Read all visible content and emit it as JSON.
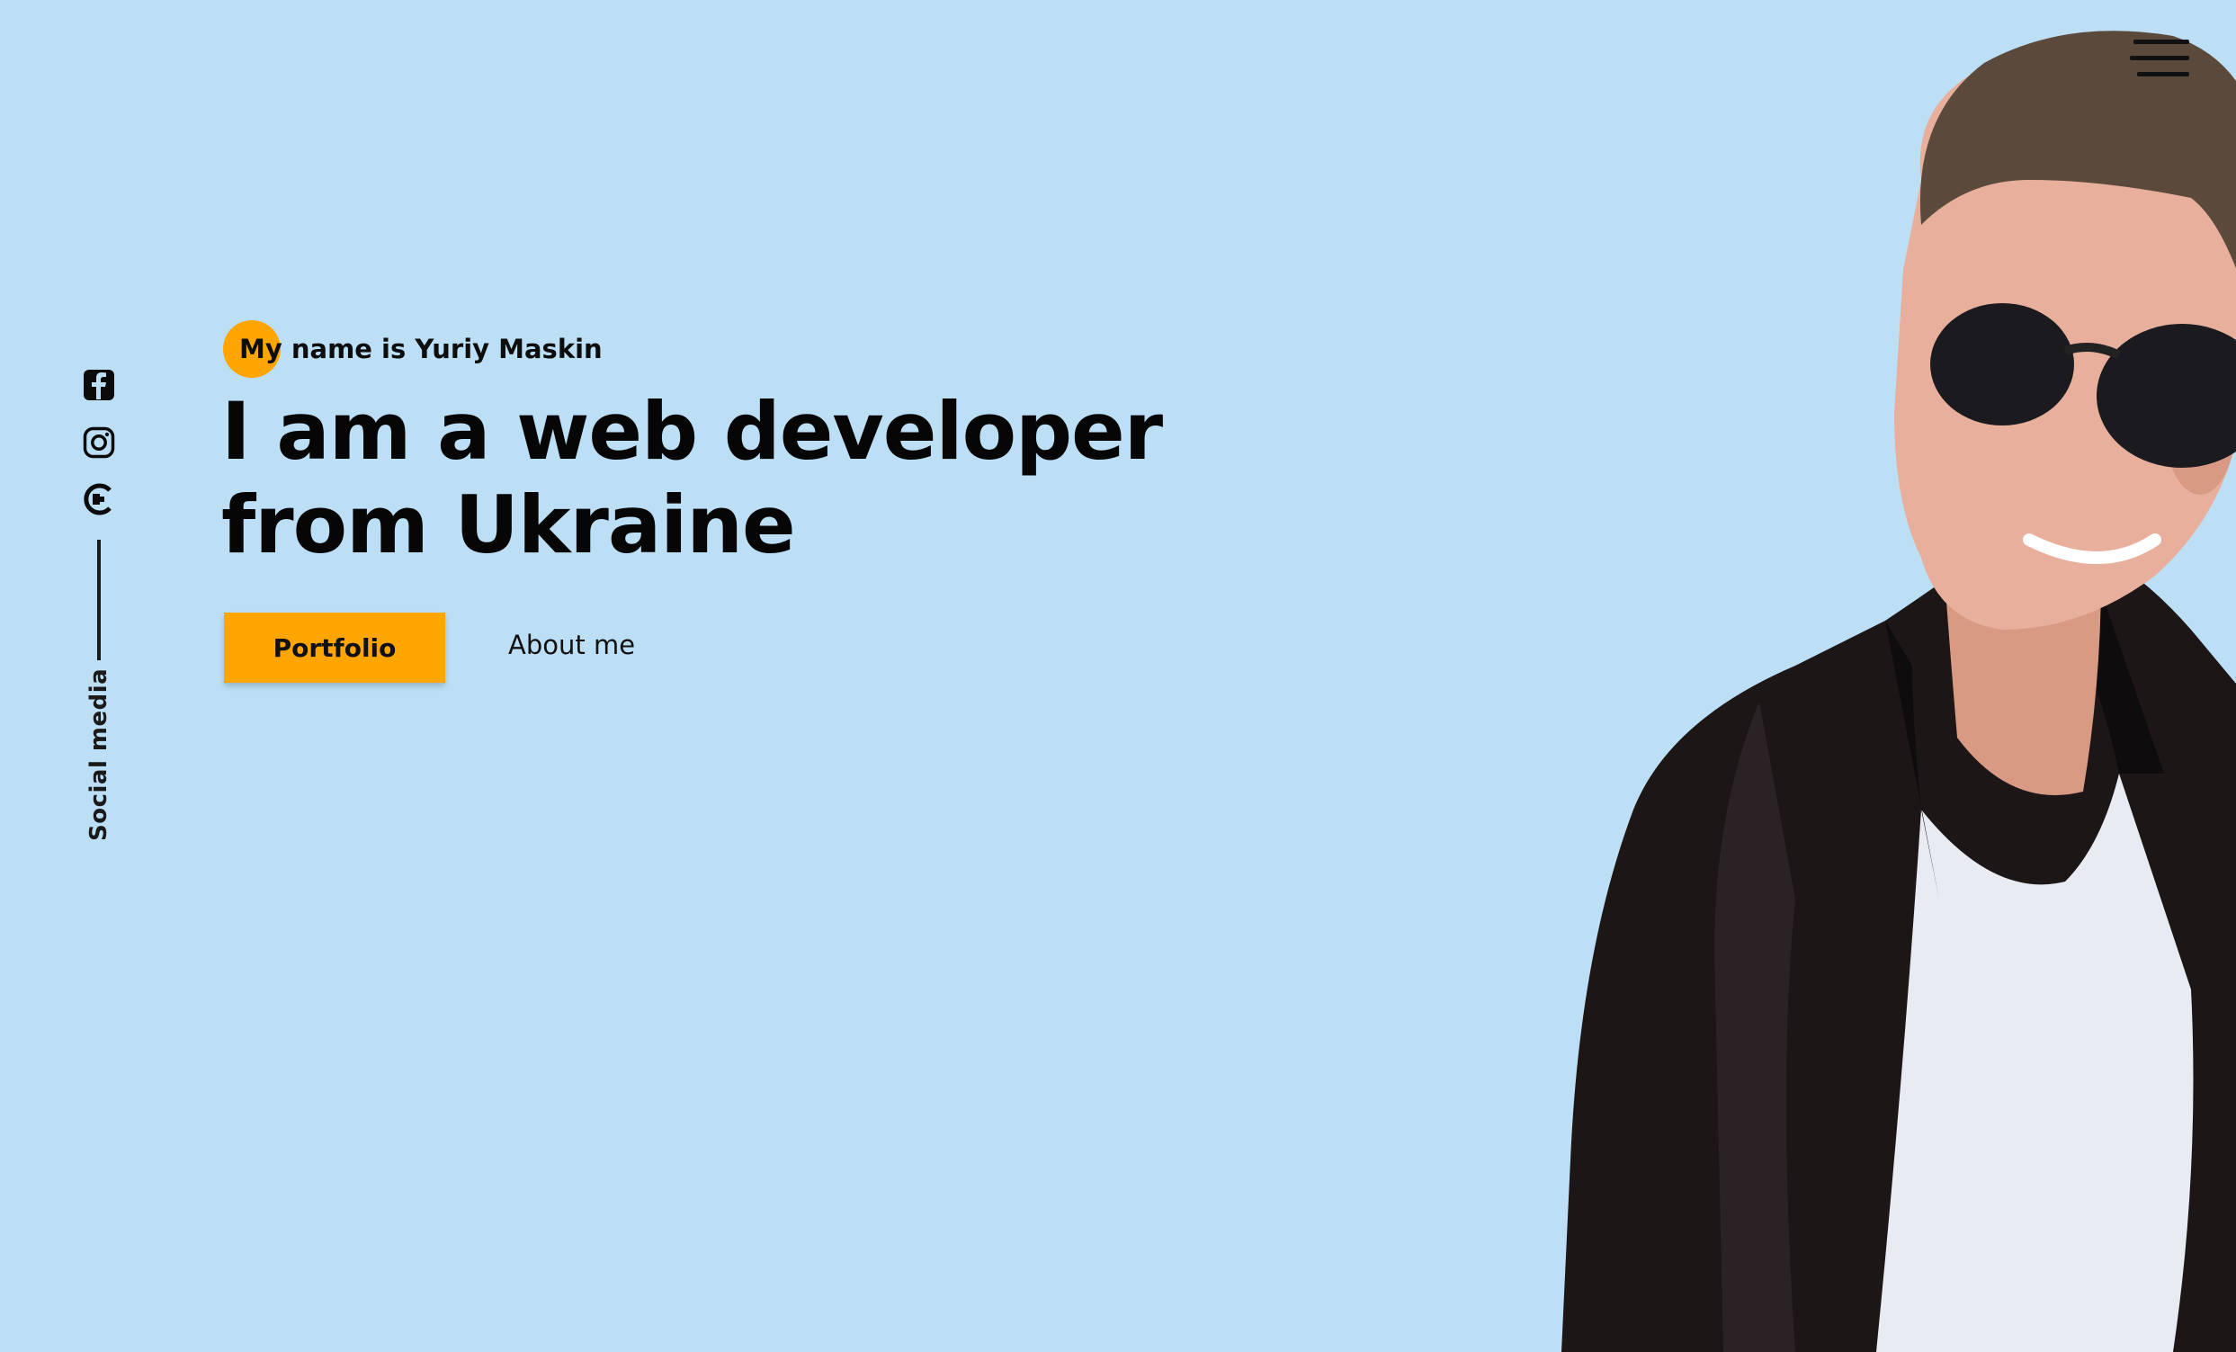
{
  "hero": {
    "greeting": "My name is Yuriy Maskin",
    "headline_line1": "I am a web developer",
    "headline_line2": "from Ukraine",
    "primary_button": "Portfolio",
    "secondary_link": "About me"
  },
  "social": {
    "label": "Social media",
    "icons": [
      "facebook-icon",
      "instagram-icon",
      "codewars-icon"
    ]
  },
  "menu": {
    "icon": "hamburger-icon"
  },
  "colors": {
    "background": "#bcdff5",
    "accent": "#ffa500",
    "text": "#0a0a0a"
  }
}
